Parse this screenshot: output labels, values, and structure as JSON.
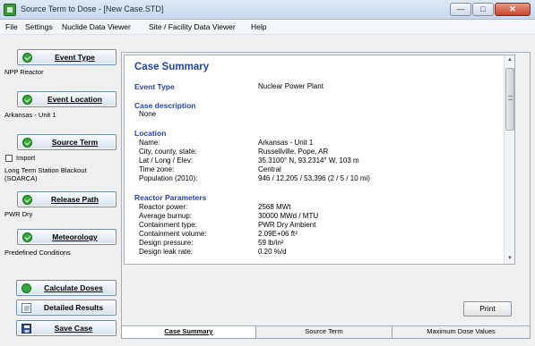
{
  "window": {
    "title": "Source Term to Dose - [New Case.STD]",
    "icon": "app-icon",
    "buttons": {
      "minimize": "—",
      "maximize": "□",
      "close": "✕"
    }
  },
  "menu": [
    "File",
    "Settings",
    "Nuclide Data Viewer",
    "Site / Facility Data Viewer",
    "Help"
  ],
  "steps": [
    {
      "label": "Event Type",
      "info": "NPP Reactor"
    },
    {
      "label": "Event Location",
      "info": "Arkansas - Unit 1"
    },
    {
      "label": "Source Term",
      "import_label": "Import",
      "info": "Long Term Station Blackout (SOARCA)"
    },
    {
      "label": "Release Path",
      "info": "PWR Dry"
    },
    {
      "label": "Meteorology",
      "info": "Predefined Conditions"
    }
  ],
  "actions": [
    {
      "label": "Calculate Doses",
      "icon": "check-icon"
    },
    {
      "label": "Detailed Results",
      "icon": "document-icon"
    },
    {
      "label": "Save Case",
      "icon": "floppy-disk-icon"
    }
  ],
  "summary": {
    "title": "Case Summary",
    "event_type_label": "Event Type",
    "event_type_value": "Nuclear Power Plant",
    "case_description_label": "Case description",
    "case_description_value": "None",
    "location_label": "Location",
    "location": [
      {
        "k": "Name:",
        "v": "Arkansas - Unit 1"
      },
      {
        "k": "City, county, state:",
        "v": "Russellville, Pope, AR"
      },
      {
        "k": "Lat / Long / Elev:",
        "v": "35.3100° N, 93.2314° W, 103 m"
      },
      {
        "k": "Time zone:",
        "v": "Central"
      },
      {
        "k": "Population (2010):",
        "v": "946 / 12,205 / 53,396 (2 / 5 / 10 mi)"
      }
    ],
    "reactor_label": "Reactor Parameters",
    "reactor": [
      {
        "k": "Reactor power:",
        "v": "2568 MWt"
      },
      {
        "k": "Average burnup:",
        "v": "30000 MWd / MTU"
      },
      {
        "k": "Containment type:",
        "v": "PWR Dry Ambient"
      },
      {
        "k": "Containment volume:",
        "v": "2.09E+06 ft³"
      },
      {
        "k": "Design pressure:",
        "v": "59 lb/in²"
      },
      {
        "k": "Design leak rate:",
        "v": "0.20 %/d"
      }
    ]
  },
  "print_label": "Print",
  "tabs": [
    "Case Summary",
    "Source Term",
    "Maximum Dose Values"
  ],
  "active_tab": "Case Summary"
}
